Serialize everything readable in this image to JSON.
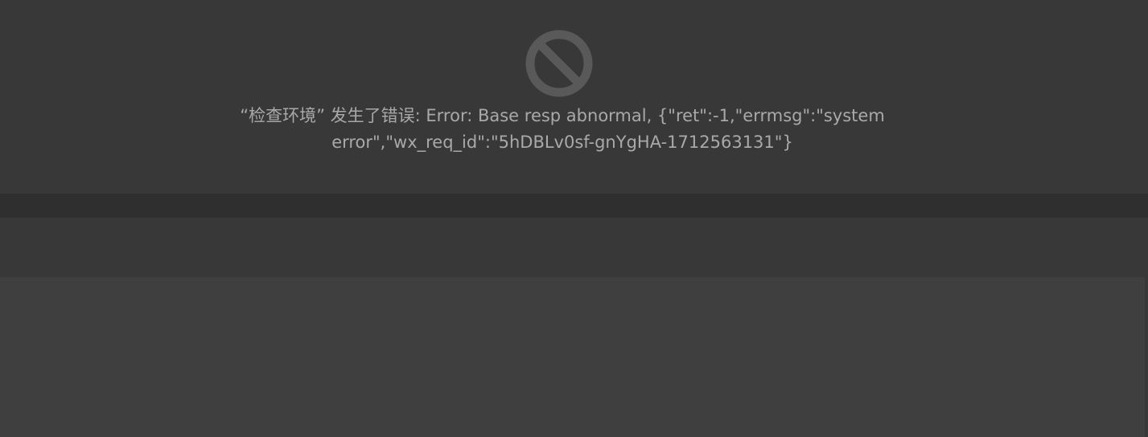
{
  "error_panel": {
    "icon": "prohibited-icon",
    "message": "“检查环境” 发生了错误: Error: Base resp abnormal, {\"ret\":-1,\"errmsg\":\"system error\",\"wx_req_id\":\"5hDBLv0sf-gnYgHA-1712563131\"}"
  },
  "colors": {
    "panel_background": "#383838",
    "divider": "#2f2f2f",
    "lower_background": "#3f3f3f",
    "icon": "#595959",
    "message_text": "#a9a9a9"
  }
}
